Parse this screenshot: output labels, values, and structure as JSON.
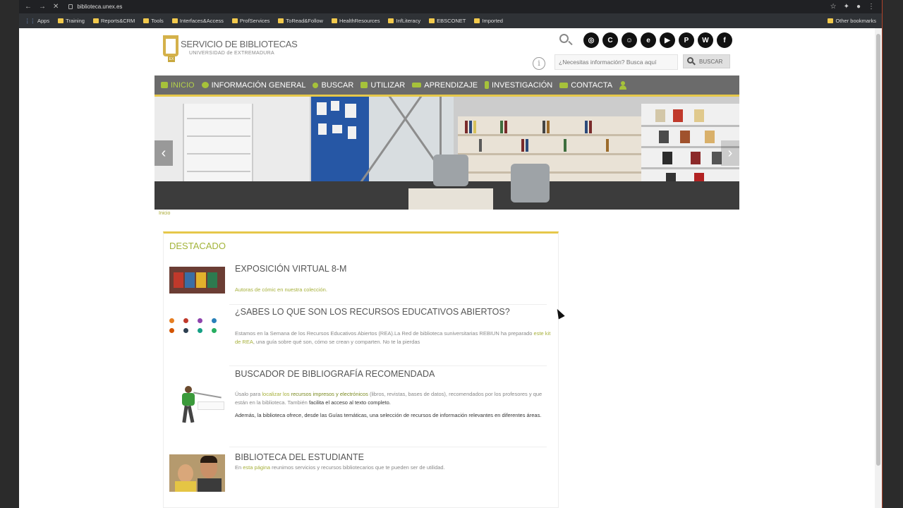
{
  "browser": {
    "url": "biblioteca.unex.es",
    "bookmarks": [
      "Apps",
      "Training",
      "Reports&CRM",
      "Tools",
      "Interfaces&Access",
      "ProfServices",
      "ToRead&Follow",
      "HealthResources",
      "InfLiteracy",
      "EBSCONET",
      "Imported"
    ],
    "other_bookmarks": "Other bookmarks"
  },
  "header": {
    "logo_title": "SERVICIO DE BIBLIOTECAS",
    "logo_subtitle": "UNIVERSIDAD de EXTREMADURA",
    "logo_badge": "EX",
    "search_placeholder": "¿Necesitas información? Busca aquí",
    "search_button": "BUSCAR",
    "social_icons": [
      "instagram-icon",
      "c-icon",
      "robot-icon",
      "ebook-icon",
      "youtube-icon",
      "pinterest-icon",
      "wordpress-icon",
      "facebook-icon"
    ]
  },
  "menu": [
    {
      "label": "INICIO",
      "icon": "home-icon",
      "active": true
    },
    {
      "label": "INFORMACIÓN GENERAL",
      "icon": "info-icon"
    },
    {
      "label": "BUSCAR",
      "icon": "search-icon"
    },
    {
      "label": "UTILIZAR",
      "icon": "book-icon"
    },
    {
      "label": "APRENDIZAJE",
      "icon": "graduation-icon"
    },
    {
      "label": "INVESTIGACIÓN",
      "icon": "research-icon"
    },
    {
      "label": "CONTACTA",
      "icon": "mail-icon"
    }
  ],
  "breadcrumb": "Inicio",
  "destacado": {
    "title": "DESTACADO",
    "items": [
      {
        "title": "EXPOSICIÓN VIRTUAL 8-M",
        "text": "Autoras de cómic en nuestra colección."
      },
      {
        "title": "¿SABES LO QUE SON LOS RECURSOS EDUCATIVOS ABIERTOS?",
        "text_a": "Estamos en la Semana de los Recursos Educativos Abiertos (REA).La Red de biblioteca suniversitarias REBIUN ha preparado ",
        "link": "este kit de REA",
        "text_b": ", una guía sobre qué son, cómo se crean y comparten. No te la pierdas"
      },
      {
        "title": "BUSCADOR DE BIBLIOGRAFÍA RECOMENDADA",
        "p1_a": "Úsalo para ",
        "p1_link1": "localizar los",
        "p1_link2": "recursos impresos y electrónicos",
        "p1_b": " (libros, revistas, bases de datos), recomendados por los profesores y que están en la biblioteca. También ",
        "p1_dark": "facilita el acceso al texto completo.",
        "p2": "Además, la biblioteca ofrece, desde las Guías temáticas, una selección de recursos de información relevantes en diferentes áreas."
      },
      {
        "title": "BIBLIOTECA DEL ESTUDIANTE",
        "text_a": "En ",
        "link": "esta página",
        "text_b": " reunimos servicios y recursos bibliotecarios que te pueden ser de utilidad."
      }
    ]
  },
  "colors": {
    "accent_green": "#a6c23a",
    "menu_gray": "#6b6b6b",
    "gold": "#e6c84a"
  }
}
